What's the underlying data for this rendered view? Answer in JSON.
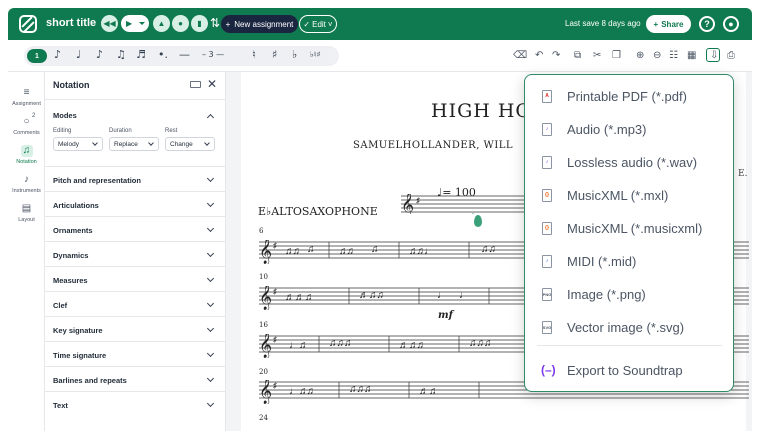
{
  "topbar": {
    "title": "short title",
    "new_assignment_label": "New assignment",
    "new_assignment_icon": "+",
    "edit_label": "Edit",
    "last_save": "Last save 8 days ago",
    "share_label": "Share",
    "help_glyph": "?"
  },
  "palette": {
    "voice": "1",
    "items": [
      "♪",
      "♩",
      "♪",
      "♫",
      "♬",
      "•.",
      "—",
      "– 3 —",
      "♮",
      "♯",
      "♭",
      "♭♮♯"
    ]
  },
  "rail": {
    "items": [
      {
        "label": "Assignment",
        "icon": "≡"
      },
      {
        "label": "Comments",
        "icon": "○",
        "badge": "2"
      },
      {
        "label": "Notation",
        "icon": "♫"
      },
      {
        "label": "Instruments",
        "icon": "♪"
      },
      {
        "label": "Layout",
        "icon": "▤"
      }
    ]
  },
  "panel": {
    "title": "Notation",
    "modes": {
      "title": "Modes",
      "editing_label": "Editing",
      "editing_value": "Melody",
      "duration_label": "Duration",
      "duration_value": "Replace",
      "rest_label": "Rest",
      "rest_value": "Change"
    },
    "sections": [
      "Pitch and representation",
      "Articulations",
      "Ornaments",
      "Dynamics",
      "Measures",
      "Clef",
      "Key signature",
      "Time signature",
      "Barlines and repeats",
      "Text"
    ]
  },
  "score": {
    "title": "HIGH HO",
    "composer": "SAMUELHOLLANDER, WILL",
    "instrument": "E♭ALTOSAXOPHONE",
    "tempo": "♩= 100",
    "dynamic": "mf",
    "measure_numbers": [
      "6",
      "10",
      "16",
      "20",
      "24"
    ]
  },
  "export_menu": {
    "items": [
      {
        "label": "Printable PDF (*.pdf)",
        "icon": "pdf-icon",
        "glyph": "A"
      },
      {
        "label": "Audio (*.mp3)",
        "icon": "audio-icon",
        "glyph": "♪"
      },
      {
        "label": "Lossless audio (*.wav)",
        "icon": "audio-icon",
        "glyph": "♪"
      },
      {
        "label": "MusicXML (*.mxl)",
        "icon": "musicxml-icon",
        "glyph": "{}"
      },
      {
        "label": "MusicXML (*.musicxml)",
        "icon": "musicxml-icon",
        "glyph": "{}"
      },
      {
        "label": "MIDI (*.mid)",
        "icon": "midi-icon",
        "glyph": "♪"
      },
      {
        "label": "Image (*.png)",
        "icon": "image-icon",
        "glyph": "PNG"
      },
      {
        "label": "Vector image (*.svg)",
        "icon": "vector-icon",
        "glyph": "SVG"
      }
    ],
    "soundtrap_label": "Export to Soundtrap"
  },
  "colors": {
    "brand": "#0f7a4f",
    "dark_button": "#1a2540",
    "menu_border": "#2e8b66"
  }
}
